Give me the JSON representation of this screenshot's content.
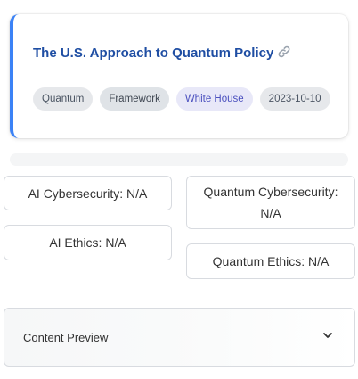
{
  "card": {
    "title": "The U.S. Approach to Quantum Policy",
    "link_icon": "link-icon",
    "accent_color": "#3b82f6",
    "tags": [
      "Quantum",
      "Framework",
      "White House",
      "2023-10-10"
    ]
  },
  "stats": {
    "ai_cybersecurity": "AI Cybersecurity: N/A",
    "quantum_cybersecurity": "Quantum Cybersecurity: N/A",
    "ai_ethics": "AI Ethics: N/A",
    "quantum_ethics": "Quantum Ethics: N/A"
  },
  "expander": {
    "label": "Content Preview",
    "icon": "chevron-down-icon"
  }
}
